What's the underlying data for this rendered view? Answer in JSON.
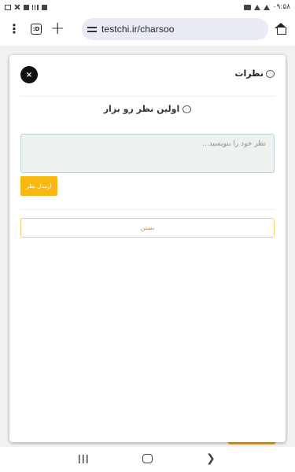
{
  "status_bar": {
    "time": "۰۹:۵۸"
  },
  "browser": {
    "url": "testchi.ir/charsoo",
    "tabs_count": ":D",
    "icons": {
      "menu": "more-vert-icon",
      "tabs": "tabs-icon",
      "new_tab": "plus-icon",
      "site_settings": "tune-icon",
      "home": "home-icon"
    }
  },
  "modal": {
    "title": "نظرات",
    "close_label": "×",
    "empty_message": "اولین نظر رو بزار",
    "comment_placeholder": "نظر خود را بنویسید...",
    "submit_label": "ارسال نظر",
    "close_text_label": "بستن"
  },
  "colors": {
    "accent": "#f8b811",
    "accent_text": "#d09a12",
    "input_bg": "#eef2ee",
    "input_border": "#b9d2dc"
  },
  "nav_bar": {
    "icons": [
      "recent-apps-icon",
      "home-circle-icon",
      "back-icon"
    ]
  }
}
